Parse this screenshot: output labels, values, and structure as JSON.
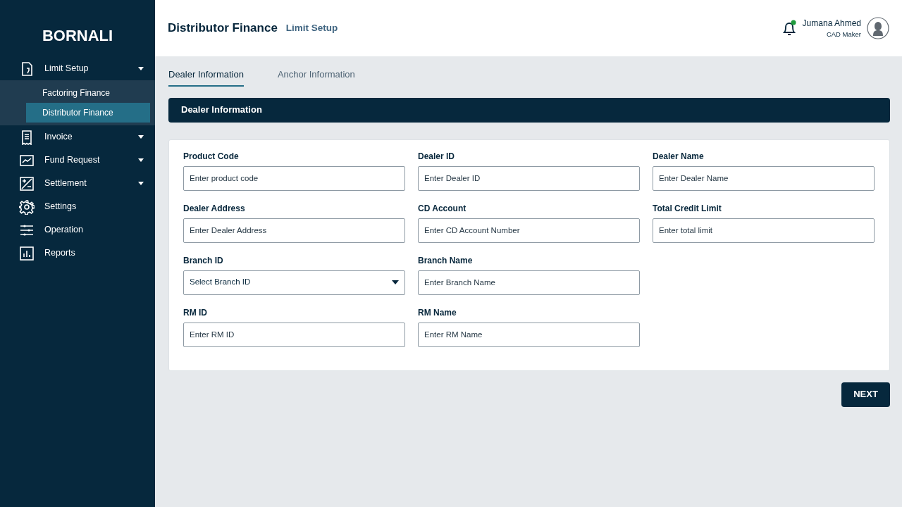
{
  "brand": "BORNALI",
  "sidebar": {
    "items": [
      {
        "label": "Limit Setup",
        "expandable": true,
        "children": [
          {
            "label": "Factoring Finance",
            "selected": false
          },
          {
            "label": "Distributor Finance",
            "selected": true
          }
        ]
      },
      {
        "label": "Invoice",
        "expandable": true
      },
      {
        "label": "Fund Request",
        "expandable": true
      },
      {
        "label": "Settlement",
        "expandable": true
      },
      {
        "label": "Settings"
      },
      {
        "label": "Operation"
      },
      {
        "label": "Reports"
      }
    ]
  },
  "header": {
    "title": "Distributor Finance",
    "subtitle": "Limit Setup",
    "user": {
      "name": "Jumana Ahmed",
      "role": "CAD Maker",
      "notification": true
    }
  },
  "tabs": [
    {
      "label": "Dealer Information",
      "selected": true
    },
    {
      "label": "Anchor Information",
      "selected": false
    }
  ],
  "section": {
    "title": "Dealer Information",
    "rows": [
      [
        {
          "label": "Product Code",
          "kind": "text",
          "placeholder": "Enter product code"
        },
        {
          "label": "Dealer ID",
          "kind": "text",
          "placeholder": "Enter Dealer ID"
        },
        {
          "label": "Dealer Name",
          "kind": "text",
          "placeholder": "Enter Dealer Name"
        }
      ],
      [
        {
          "label": "Dealer Address",
          "kind": "text",
          "placeholder": "Enter Dealer Address"
        },
        {
          "label": "CD Account",
          "kind": "text",
          "placeholder": "Enter CD Account Number"
        },
        {
          "label": "Total Credit Limit",
          "kind": "text",
          "placeholder": "Enter total limit"
        }
      ],
      [
        {
          "label": "Branch ID",
          "kind": "select",
          "placeholder": "Select Branch ID"
        },
        {
          "label": "Branch Name",
          "kind": "text",
          "placeholder": "Enter Branch Name"
        }
      ],
      [
        {
          "label": "RM ID",
          "kind": "text",
          "placeholder": "Enter RM ID"
        },
        {
          "label": "RM Name",
          "kind": "text",
          "placeholder": "Enter RM Name"
        }
      ]
    ]
  },
  "next_button": "NEXT"
}
